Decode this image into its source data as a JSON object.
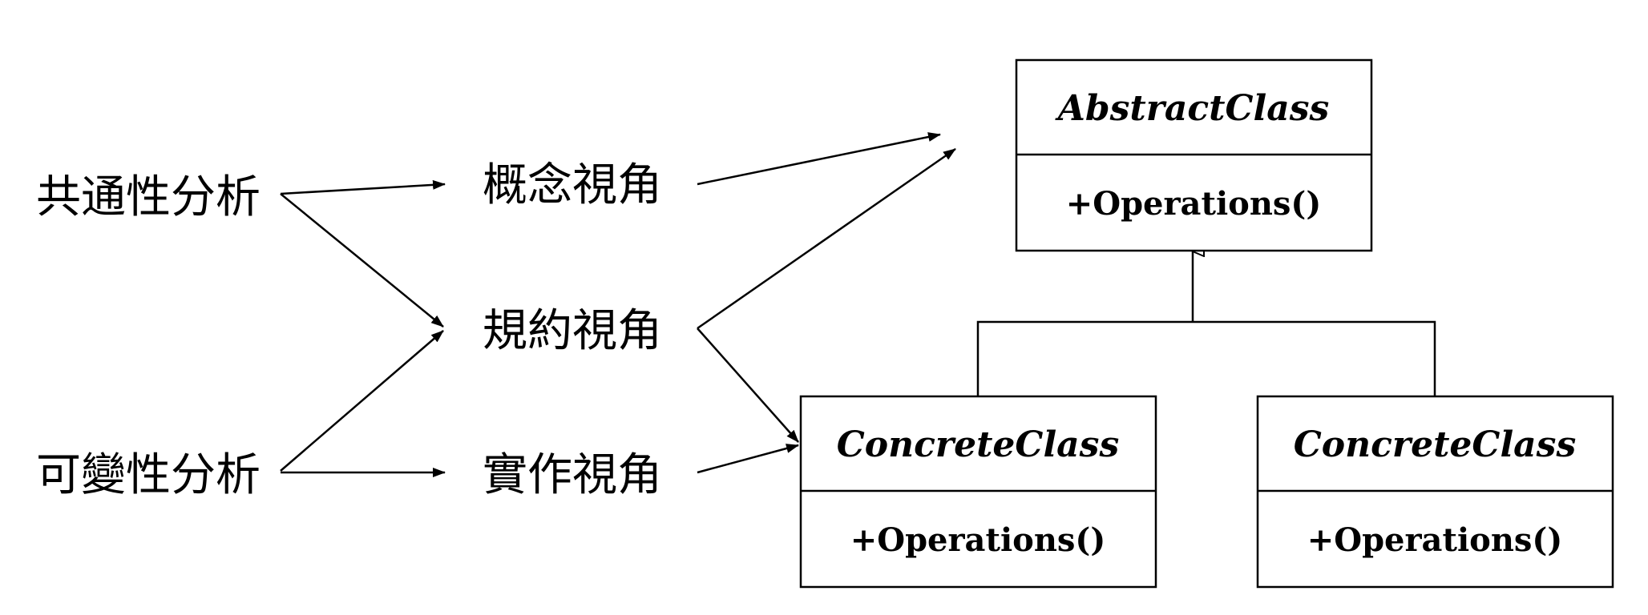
{
  "analysis": {
    "commonality": "共通性分析",
    "variability": "可變性分析"
  },
  "perspectives": {
    "conceptual": "概念視角",
    "specification": "規約視角",
    "implementation": "實作視角"
  },
  "classes": {
    "abstract": {
      "name": "AbstractClass",
      "operations": "+Operations()"
    },
    "concrete_left": {
      "name": "ConcreteClass",
      "operations": "+Operations()"
    },
    "concrete_right": {
      "name": "ConcreteClass",
      "operations": "+Operations()"
    }
  },
  "colors": {
    "stroke": "#000000",
    "background": "#ffffff"
  }
}
